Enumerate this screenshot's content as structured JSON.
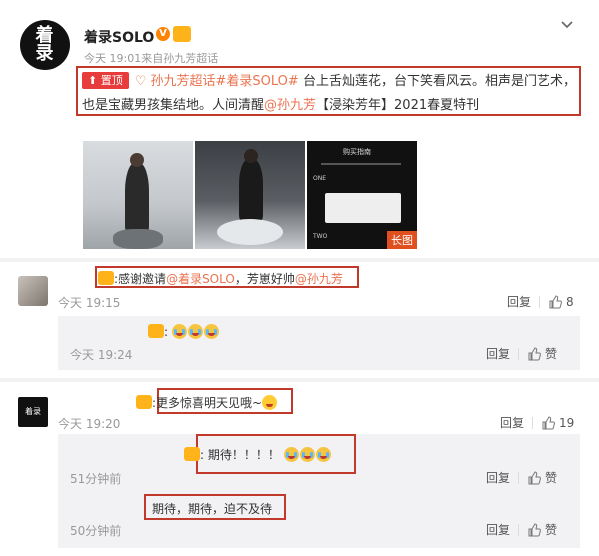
{
  "post": {
    "avatar_text": "着录",
    "author": "着录SOLO",
    "v_badge": "V",
    "vip_badge": "会员",
    "time": "今天 19:01",
    "source": "来自孙九芳超话",
    "pin_label": "置顶",
    "text_link1": "孙九芳超话#着录SOLO#",
    "text_part1": " 台上舌灿莲花，台下笑看风云。相声是门艺术，也是宝藏男孩集结地。人间清醒",
    "text_link2": "@孙九芳",
    "text_part2": "【浸染芳年】2021春夏特刊",
    "long_image_tag": "长图",
    "thumb3_title": "购买指南",
    "thumb3_step1": "ONE",
    "thumb3_step2": "TWO"
  },
  "comments": [
    {
      "name_badge": "会员",
      "text_prefix": "感谢邀请",
      "link1": "@着录SOLO",
      "text_mid": "，芳崽好帅",
      "link2": "@孙九芳",
      "time": "今天 19:15",
      "reply_label": "回复",
      "like_count": "8",
      "replies": [
        {
          "name_badge": "会员",
          "time": "今天 19:24",
          "reply_label": "回复",
          "like_label": "赞"
        }
      ]
    },
    {
      "avatar_text": "着录",
      "name_badge": "会员",
      "text": "更多惊喜明天见哦~",
      "time": "今天 19:20",
      "reply_label": "回复",
      "like_count": "19",
      "replies": [
        {
          "name_badge": "会员",
          "text": "期待！！！！",
          "time": "51分钟前",
          "reply_label": "回复",
          "like_label": "赞"
        },
        {
          "text": "期待，期待，迫不及待",
          "time": "50分钟前",
          "reply_label": "回复",
          "like_label": "赞"
        }
      ]
    }
  ],
  "colors": {
    "link": "#eb7350",
    "highlight": "#c0392b",
    "pin": "#e83b3b",
    "reply_bg": "#f2f2f5"
  }
}
